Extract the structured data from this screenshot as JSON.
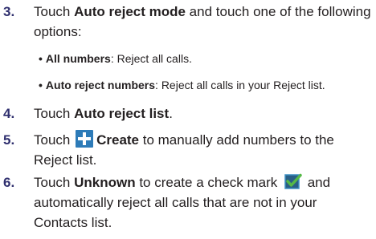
{
  "steps": [
    {
      "number": "3.",
      "pre": "Touch ",
      "bold": "Auto reject mode",
      "post": " and touch one of the following",
      "line2": "options:",
      "bullets": [
        {
          "mark": "•",
          "bold": "All numbers",
          "text": ": Reject all calls."
        },
        {
          "mark": "•",
          "bold": "Auto reject numbers",
          "text": ": Reject all calls in your Reject list."
        }
      ]
    },
    {
      "number": "4.",
      "pre": "Touch ",
      "bold": "Auto reject list",
      "post": "."
    },
    {
      "number": "5.",
      "pre": "Touch ",
      "bold": "Create",
      "post": " to manually add numbers to the",
      "line2": "Reject list."
    },
    {
      "number": "6.",
      "pre": "Touch ",
      "bold": "Unknown",
      "post": " to create a check mark ",
      "post2": " and",
      "line2": "automatically reject all calls that are not in your",
      "line3": "Contacts list."
    }
  ],
  "icons": {
    "plus_color": "#2d7bb8",
    "check_color": "#55b947",
    "check_box_color": "#3c8fc2"
  }
}
